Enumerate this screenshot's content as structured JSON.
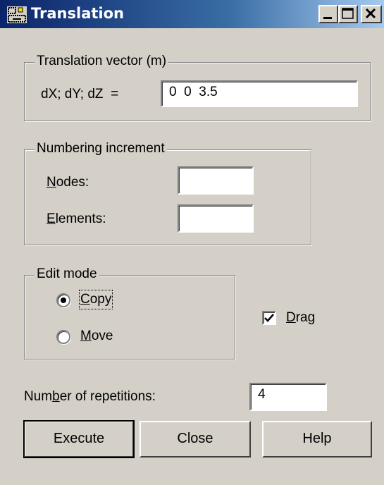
{
  "window": {
    "title": "Translation"
  },
  "translation_group": {
    "legend": "Translation vector (m)",
    "label": "dX; dY; dZ  =",
    "value": "0  0  3.5"
  },
  "numbering_group": {
    "legend": "Numbering increment",
    "nodes": {
      "accel": "N",
      "rest": "odes:",
      "value": ""
    },
    "elements": {
      "accel": "E",
      "rest": "lements:",
      "value": ""
    }
  },
  "edit_mode_group": {
    "legend": "Edit mode",
    "copy": {
      "accel": "C",
      "rest": "opy",
      "selected": true
    },
    "move": {
      "accel": "M",
      "rest": "ove",
      "selected": false
    }
  },
  "drag": {
    "accel": "D",
    "rest": "rag",
    "checked": true
  },
  "repetitions": {
    "pre": "Num",
    "accel": "b",
    "post": "er of repetitions:",
    "value": "4"
  },
  "buttons": {
    "execute": "Execute",
    "close": "Close",
    "help": "Help"
  }
}
